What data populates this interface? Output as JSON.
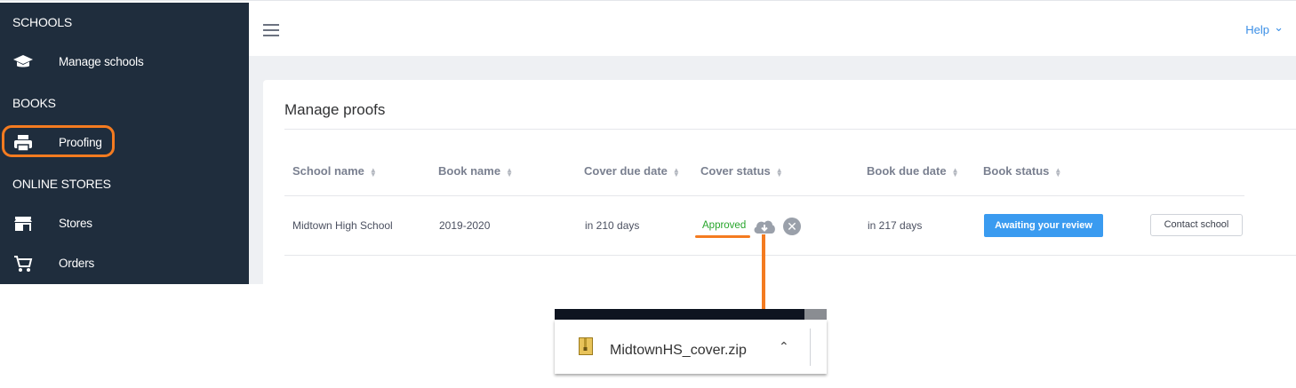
{
  "sidebar": {
    "sections": [
      {
        "title": "SCHOOLS",
        "items": [
          {
            "label": "Manage schools",
            "icon": "graduation-cap-icon"
          }
        ]
      },
      {
        "title": "BOOKS",
        "items": [
          {
            "label": "Proofing",
            "icon": "printer-icon"
          }
        ]
      },
      {
        "title": "ONLINE STORES",
        "items": [
          {
            "label": "Stores",
            "icon": "store-icon"
          },
          {
            "label": "Orders",
            "icon": "cart-icon"
          }
        ]
      }
    ],
    "highlighted_item": "Proofing"
  },
  "header": {
    "menu_icon": "hamburger-icon",
    "help_label": "Help",
    "help_icon": "chevron-down-icon"
  },
  "main": {
    "title": "Manage proofs",
    "table": {
      "columns": [
        "School name",
        "Book name",
        "Cover due date",
        "Cover status",
        "Book due date",
        "Book status"
      ],
      "rows": [
        {
          "school_name": "Midtown High School",
          "book_name": "2019-2020",
          "cover_due": "in 210 days",
          "cover_status": "Approved",
          "book_due": "in 217 days",
          "book_status": "Awaiting your review",
          "action": "Contact school"
        }
      ]
    }
  },
  "download_bar": {
    "file_name": "MidtownHS_cover.zip",
    "file_icon": "zip-file-icon",
    "caret_icon": "chevron-up-icon"
  },
  "colors": {
    "sidebar_bg": "#1f2d3d",
    "accent_blue": "#3a9bf0",
    "approved_green": "#27a52b",
    "annotation_orange": "#f47b20"
  }
}
